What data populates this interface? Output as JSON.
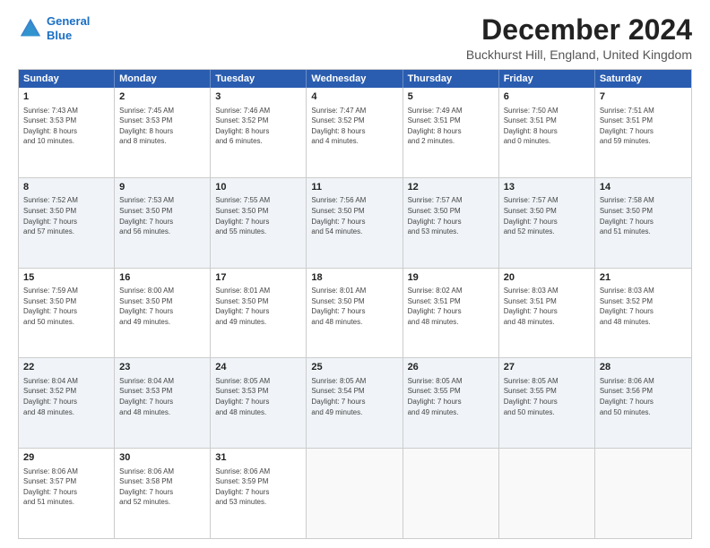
{
  "header": {
    "logo": {
      "line1": "General",
      "line2": "Blue"
    },
    "title": "December 2024",
    "subtitle": "Buckhurst Hill, England, United Kingdom"
  },
  "calendar": {
    "days_of_week": [
      "Sunday",
      "Monday",
      "Tuesday",
      "Wednesday",
      "Thursday",
      "Friday",
      "Saturday"
    ],
    "rows": [
      [
        {
          "day": "1",
          "text": "Sunrise: 7:43 AM\nSunset: 3:53 PM\nDaylight: 8 hours\nand 10 minutes."
        },
        {
          "day": "2",
          "text": "Sunrise: 7:45 AM\nSunset: 3:53 PM\nDaylight: 8 hours\nand 8 minutes."
        },
        {
          "day": "3",
          "text": "Sunrise: 7:46 AM\nSunset: 3:52 PM\nDaylight: 8 hours\nand 6 minutes."
        },
        {
          "day": "4",
          "text": "Sunrise: 7:47 AM\nSunset: 3:52 PM\nDaylight: 8 hours\nand 4 minutes."
        },
        {
          "day": "5",
          "text": "Sunrise: 7:49 AM\nSunset: 3:51 PM\nDaylight: 8 hours\nand 2 minutes."
        },
        {
          "day": "6",
          "text": "Sunrise: 7:50 AM\nSunset: 3:51 PM\nDaylight: 8 hours\nand 0 minutes."
        },
        {
          "day": "7",
          "text": "Sunrise: 7:51 AM\nSunset: 3:51 PM\nDaylight: 7 hours\nand 59 minutes."
        }
      ],
      [
        {
          "day": "8",
          "text": "Sunrise: 7:52 AM\nSunset: 3:50 PM\nDaylight: 7 hours\nand 57 minutes."
        },
        {
          "day": "9",
          "text": "Sunrise: 7:53 AM\nSunset: 3:50 PM\nDaylight: 7 hours\nand 56 minutes."
        },
        {
          "day": "10",
          "text": "Sunrise: 7:55 AM\nSunset: 3:50 PM\nDaylight: 7 hours\nand 55 minutes."
        },
        {
          "day": "11",
          "text": "Sunrise: 7:56 AM\nSunset: 3:50 PM\nDaylight: 7 hours\nand 54 minutes."
        },
        {
          "day": "12",
          "text": "Sunrise: 7:57 AM\nSunset: 3:50 PM\nDaylight: 7 hours\nand 53 minutes."
        },
        {
          "day": "13",
          "text": "Sunrise: 7:57 AM\nSunset: 3:50 PM\nDaylight: 7 hours\nand 52 minutes."
        },
        {
          "day": "14",
          "text": "Sunrise: 7:58 AM\nSunset: 3:50 PM\nDaylight: 7 hours\nand 51 minutes."
        }
      ],
      [
        {
          "day": "15",
          "text": "Sunrise: 7:59 AM\nSunset: 3:50 PM\nDaylight: 7 hours\nand 50 minutes."
        },
        {
          "day": "16",
          "text": "Sunrise: 8:00 AM\nSunset: 3:50 PM\nDaylight: 7 hours\nand 49 minutes."
        },
        {
          "day": "17",
          "text": "Sunrise: 8:01 AM\nSunset: 3:50 PM\nDaylight: 7 hours\nand 49 minutes."
        },
        {
          "day": "18",
          "text": "Sunrise: 8:01 AM\nSunset: 3:50 PM\nDaylight: 7 hours\nand 48 minutes."
        },
        {
          "day": "19",
          "text": "Sunrise: 8:02 AM\nSunset: 3:51 PM\nDaylight: 7 hours\nand 48 minutes."
        },
        {
          "day": "20",
          "text": "Sunrise: 8:03 AM\nSunset: 3:51 PM\nDaylight: 7 hours\nand 48 minutes."
        },
        {
          "day": "21",
          "text": "Sunrise: 8:03 AM\nSunset: 3:52 PM\nDaylight: 7 hours\nand 48 minutes."
        }
      ],
      [
        {
          "day": "22",
          "text": "Sunrise: 8:04 AM\nSunset: 3:52 PM\nDaylight: 7 hours\nand 48 minutes."
        },
        {
          "day": "23",
          "text": "Sunrise: 8:04 AM\nSunset: 3:53 PM\nDaylight: 7 hours\nand 48 minutes."
        },
        {
          "day": "24",
          "text": "Sunrise: 8:05 AM\nSunset: 3:53 PM\nDaylight: 7 hours\nand 48 minutes."
        },
        {
          "day": "25",
          "text": "Sunrise: 8:05 AM\nSunset: 3:54 PM\nDaylight: 7 hours\nand 49 minutes."
        },
        {
          "day": "26",
          "text": "Sunrise: 8:05 AM\nSunset: 3:55 PM\nDaylight: 7 hours\nand 49 minutes."
        },
        {
          "day": "27",
          "text": "Sunrise: 8:05 AM\nSunset: 3:55 PM\nDaylight: 7 hours\nand 50 minutes."
        },
        {
          "day": "28",
          "text": "Sunrise: 8:06 AM\nSunset: 3:56 PM\nDaylight: 7 hours\nand 50 minutes."
        }
      ],
      [
        {
          "day": "29",
          "text": "Sunrise: 8:06 AM\nSunset: 3:57 PM\nDaylight: 7 hours\nand 51 minutes."
        },
        {
          "day": "30",
          "text": "Sunrise: 8:06 AM\nSunset: 3:58 PM\nDaylight: 7 hours\nand 52 minutes."
        },
        {
          "day": "31",
          "text": "Sunrise: 8:06 AM\nSunset: 3:59 PM\nDaylight: 7 hours\nand 53 minutes."
        },
        {
          "day": "",
          "text": ""
        },
        {
          "day": "",
          "text": ""
        },
        {
          "day": "",
          "text": ""
        },
        {
          "day": "",
          "text": ""
        }
      ]
    ]
  }
}
